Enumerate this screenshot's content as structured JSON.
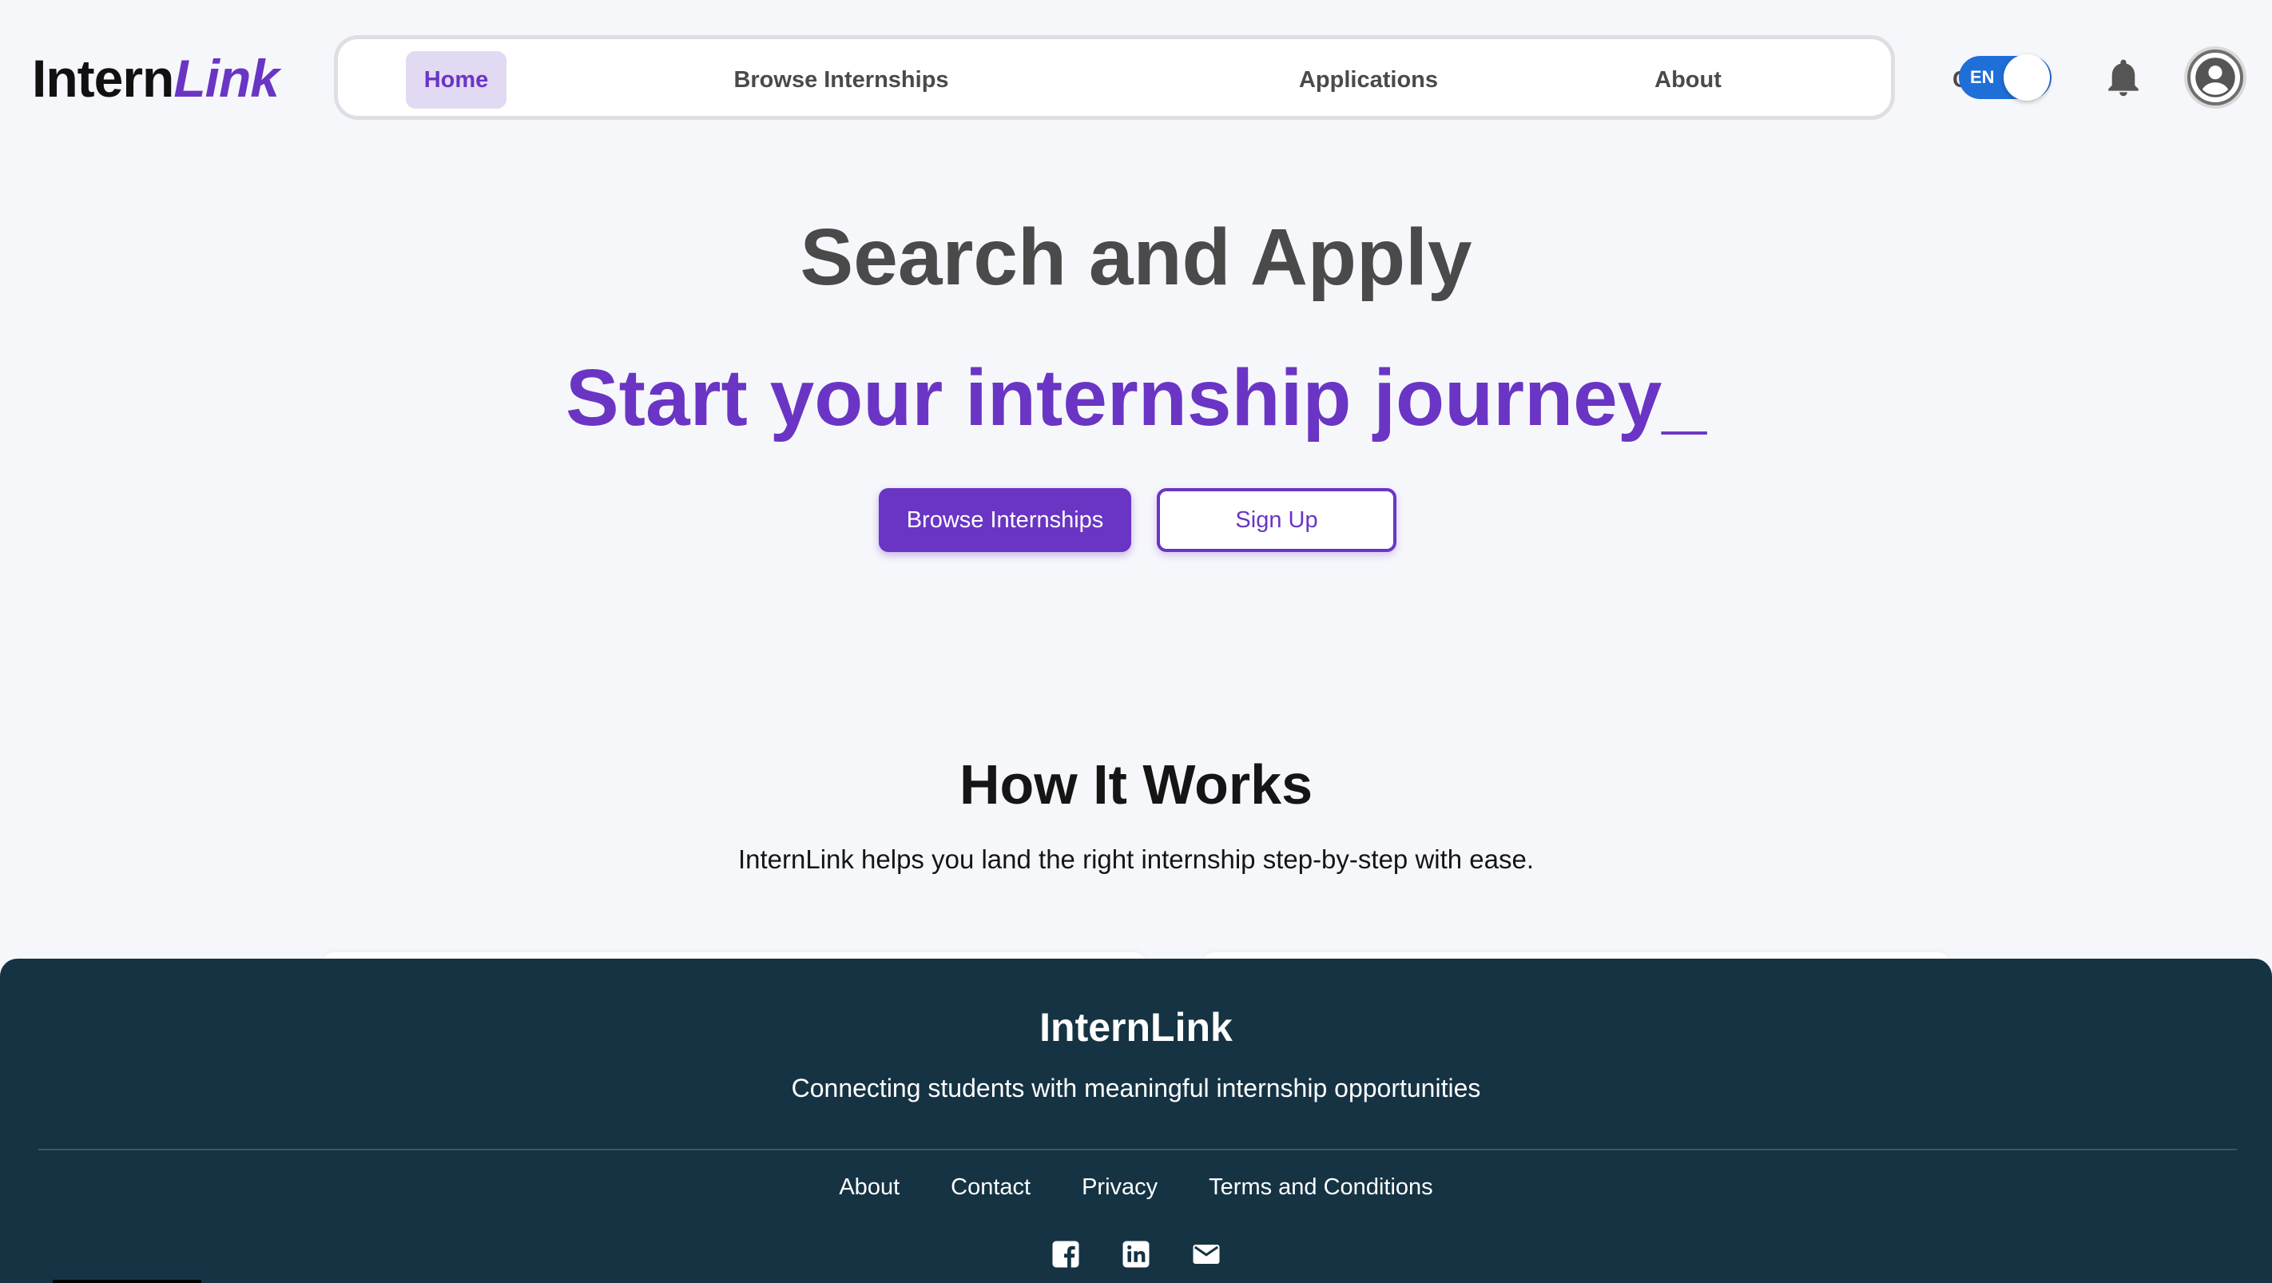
{
  "header": {
    "logo_part1": "Intern",
    "logo_part2": "Link",
    "nav": {
      "home": "Home",
      "browse": "Browse Internships",
      "applications": "Applications",
      "about": "About",
      "contact": "Contact"
    },
    "active_nav": "home",
    "language_label": "EN",
    "icons": [
      "bell-icon",
      "user-avatar-icon"
    ]
  },
  "hero": {
    "title": "Search and Apply",
    "subtitle": "Start your internship journey_",
    "primary_button": "Browse Internships",
    "secondary_button": "Sign Up"
  },
  "how_it_works": {
    "title": "How It Works",
    "description": "InternLink helps you land the right internship step-by-step with ease."
  },
  "footer": {
    "brand": "InternLink",
    "tagline": "Connecting students with meaningful internship opportunities",
    "links": {
      "about": "About",
      "contact": "Contact",
      "privacy": "Privacy",
      "terms": "Terms and Conditions"
    },
    "social_icons": [
      "facebook-icon",
      "linkedin-icon",
      "email-icon"
    ]
  },
  "colors": {
    "accent": "#6a35c4",
    "accent_soft": "#e2d9f3",
    "page_bg": "#f6f7fb",
    "footer_bg": "#153343",
    "toggle": "#1f6fd8",
    "heading_gray": "#4a4a4a"
  }
}
